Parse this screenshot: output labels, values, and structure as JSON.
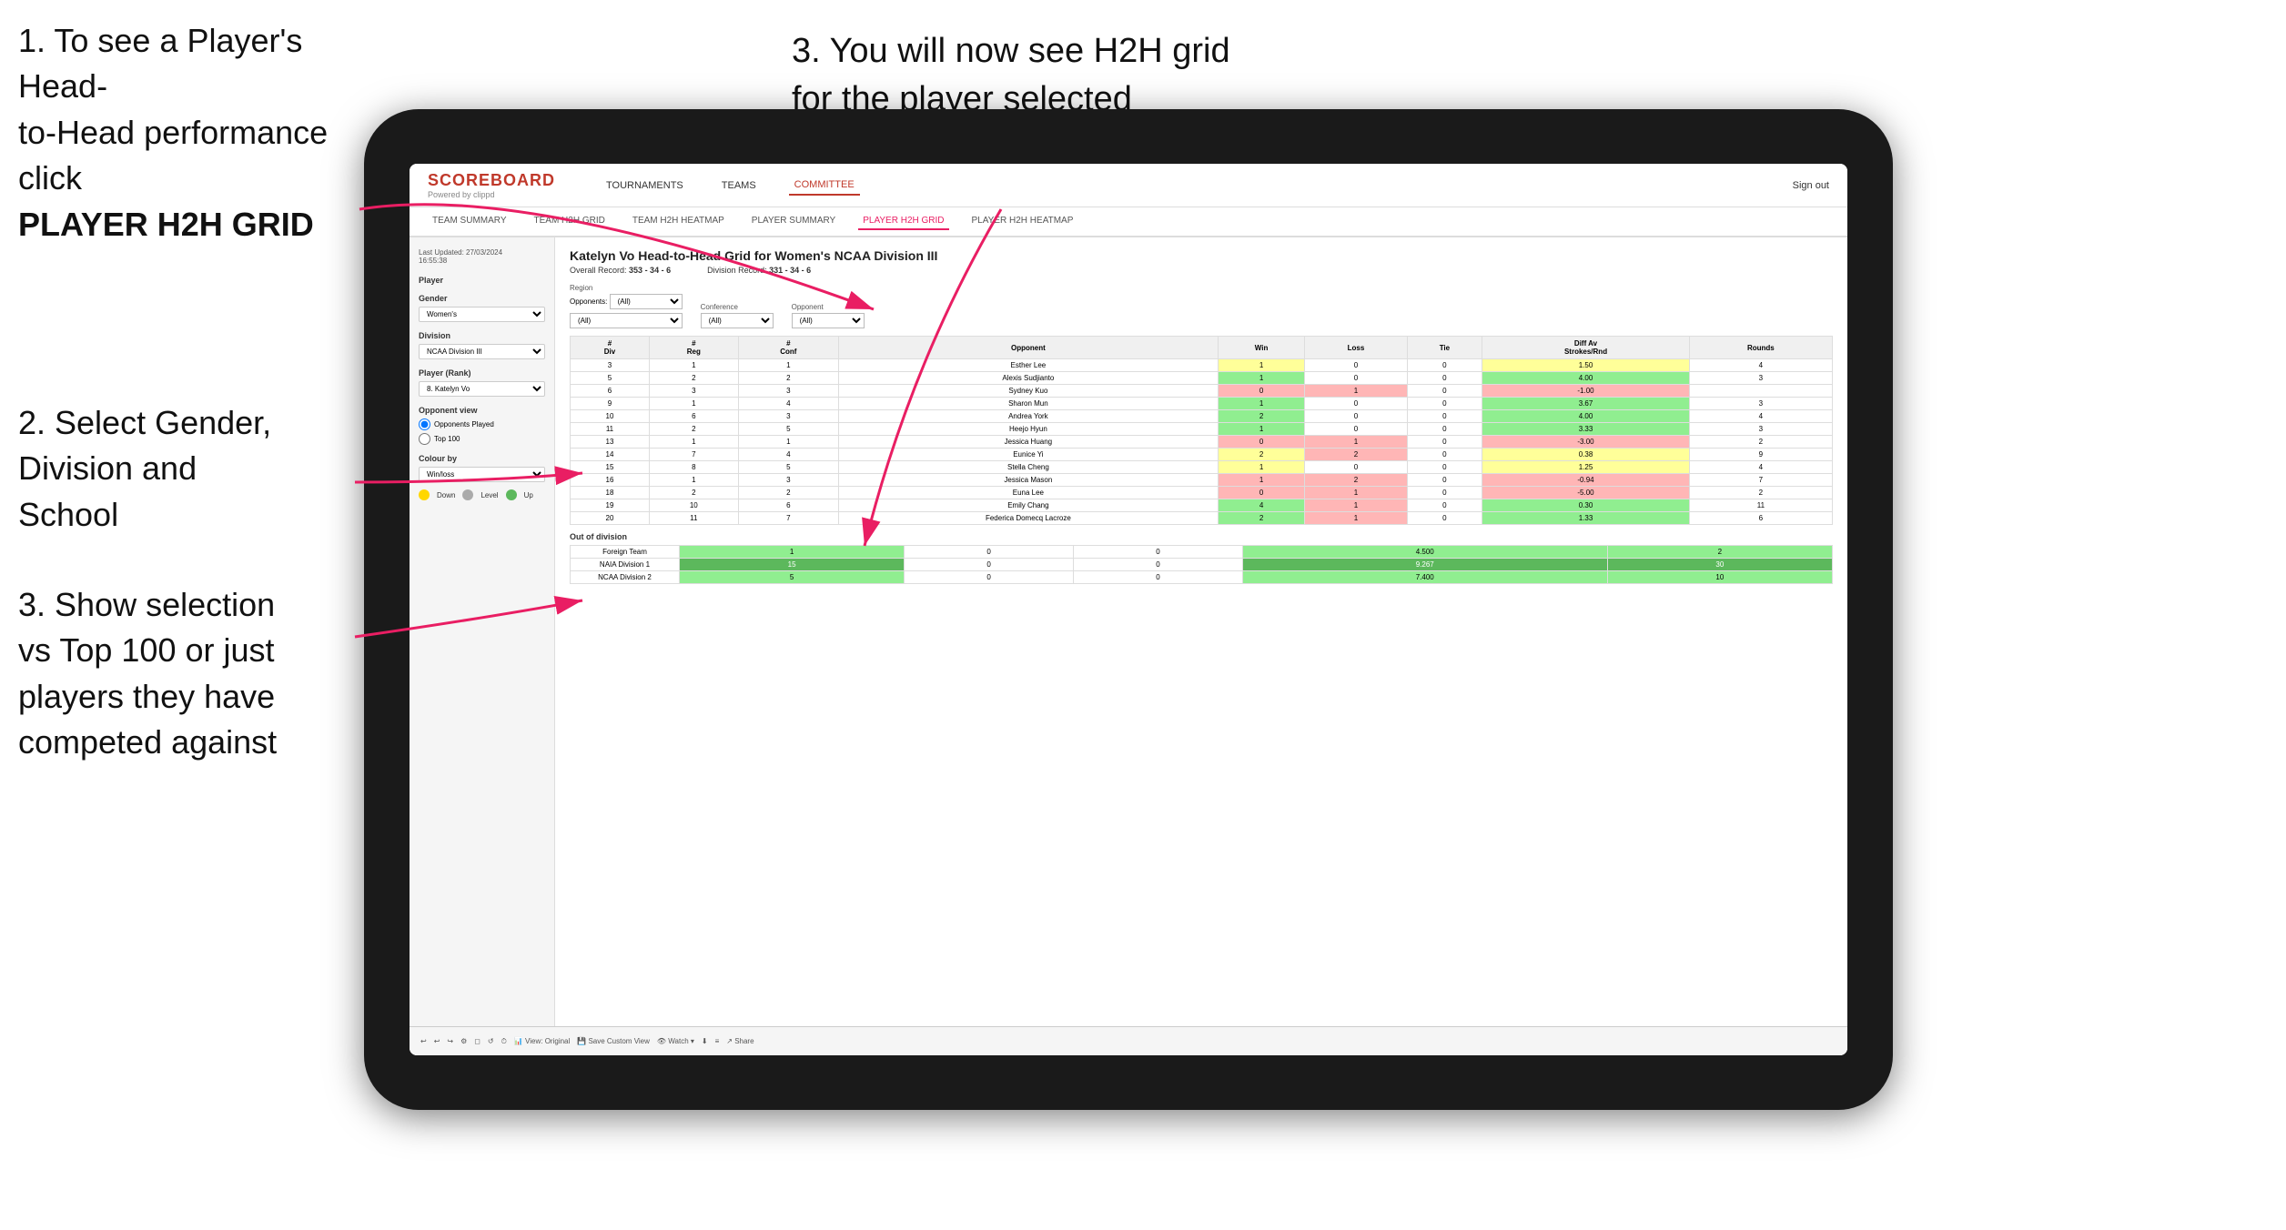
{
  "instructions": {
    "step1_line1": "1. To see a Player's Head-",
    "step1_line2": "to-Head performance click",
    "step1_bold": "PLAYER H2H GRID",
    "step2_title": "2. Select Gender,",
    "step2_line2": "Division and",
    "step2_line3": "School",
    "step3_title": "3. You will now see H2H grid",
    "step3_line2": "for the player selected",
    "step3b_title": "3. Show selection",
    "step3b_line2": "vs Top 100 or just",
    "step3b_line3": "players they have",
    "step3b_line4": "competed against"
  },
  "nav": {
    "logo": "SCOREBOARD",
    "logo_sub": "Powered by clippd",
    "items": [
      "TOURNAMENTS",
      "TEAMS",
      "COMMITTEE"
    ],
    "sign_out": "Sign out",
    "active": "COMMITTEE"
  },
  "sub_nav": {
    "items": [
      "TEAM SUMMARY",
      "TEAM H2H GRID",
      "TEAM H2H HEATMAP",
      "PLAYER SUMMARY",
      "PLAYER H2H GRID",
      "PLAYER H2H HEATMAP"
    ],
    "active": "PLAYER H2H GRID"
  },
  "sidebar": {
    "updated": "Last Updated: 27/03/2024",
    "updated2": "16:55:38",
    "player_label": "Player",
    "gender_label": "Gender",
    "gender_value": "Women's",
    "division_label": "Division",
    "division_value": "NCAA Division III",
    "player_rank_label": "Player (Rank)",
    "player_rank_value": "8. Katelyn Vo",
    "opponent_view_label": "Opponent view",
    "radio1": "Opponents Played",
    "radio2": "Top 100",
    "colour_label": "Colour by",
    "colour_value": "Win/loss",
    "legend_down": "Down",
    "legend_level": "Level",
    "legend_up": "Up"
  },
  "main": {
    "title": "Katelyn Vo Head-to-Head Grid for Women's NCAA Division III",
    "overall_record_label": "Overall Record:",
    "overall_record": "353 - 34 - 6",
    "division_record_label": "Division Record:",
    "division_record": "331 - 34 - 6",
    "opponents_label": "Opponents:",
    "opponents_value": "(All)",
    "region_label": "Region",
    "conference_label": "Conference",
    "opponent_label": "Opponent",
    "col_div": "#\nDiv",
    "col_reg": "#\nReg",
    "col_conf": "#\nConf",
    "col_opponent": "Opponent",
    "col_win": "Win",
    "col_loss": "Loss",
    "col_tie": "Tie",
    "col_diff": "Diff Av\nStrokes/Rnd",
    "col_rounds": "Rounds"
  },
  "table_rows": [
    {
      "div": 3,
      "reg": 1,
      "conf": 1,
      "opponent": "Esther Lee",
      "win": 1,
      "loss": 0,
      "tie": 0,
      "diff": 1.5,
      "rounds": 4,
      "win_color": "yellow"
    },
    {
      "div": 5,
      "reg": 2,
      "conf": 2,
      "opponent": "Alexis Sudjianto",
      "win": 1,
      "loss": 0,
      "tie": 0,
      "diff": 4.0,
      "rounds": 3,
      "win_color": "green"
    },
    {
      "div": 6,
      "reg": 3,
      "conf": 3,
      "opponent": "Sydney Kuo",
      "win": 0,
      "loss": 1,
      "tie": 0,
      "diff": -1.0,
      "rounds": null,
      "win_color": "red"
    },
    {
      "div": 9,
      "reg": 1,
      "conf": 4,
      "opponent": "Sharon Mun",
      "win": 1,
      "loss": 0,
      "tie": 0,
      "diff": 3.67,
      "rounds": 3,
      "win_color": "green"
    },
    {
      "div": 10,
      "reg": 6,
      "conf": 3,
      "opponent": "Andrea York",
      "win": 2,
      "loss": 0,
      "tie": 0,
      "diff": 4.0,
      "rounds": 4,
      "win_color": "green"
    },
    {
      "div": 11,
      "reg": 2,
      "conf": 5,
      "opponent": "Heejo Hyun",
      "win": 1,
      "loss": 0,
      "tie": 0,
      "diff": 3.33,
      "rounds": 3,
      "win_color": "green"
    },
    {
      "div": 13,
      "reg": 1,
      "conf": 1,
      "opponent": "Jessica Huang",
      "win": 0,
      "loss": 1,
      "tie": 0,
      "diff": -3.0,
      "rounds": 2,
      "win_color": "red"
    },
    {
      "div": 14,
      "reg": 7,
      "conf": 4,
      "opponent": "Eunice Yi",
      "win": 2,
      "loss": 2,
      "tie": 0,
      "diff": 0.38,
      "rounds": 9,
      "win_color": "yellow"
    },
    {
      "div": 15,
      "reg": 8,
      "conf": 5,
      "opponent": "Stella Cheng",
      "win": 1,
      "loss": 0,
      "tie": 0,
      "diff": 1.25,
      "rounds": 4,
      "win_color": "yellow"
    },
    {
      "div": 16,
      "reg": 1,
      "conf": 3,
      "opponent": "Jessica Mason",
      "win": 1,
      "loss": 2,
      "tie": 0,
      "diff": -0.94,
      "rounds": 7,
      "win_color": "red"
    },
    {
      "div": 18,
      "reg": 2,
      "conf": 2,
      "opponent": "Euna Lee",
      "win": 0,
      "loss": 1,
      "tie": 0,
      "diff": -5.0,
      "rounds": 2,
      "win_color": "red"
    },
    {
      "div": 19,
      "reg": 10,
      "conf": 6,
      "opponent": "Emily Chang",
      "win": 4,
      "loss": 1,
      "tie": 0,
      "diff": 0.3,
      "rounds": 11,
      "win_color": "green"
    },
    {
      "div": 20,
      "reg": 11,
      "conf": 7,
      "opponent": "Federica Domecq Lacroze",
      "win": 2,
      "loss": 1,
      "tie": 0,
      "diff": 1.33,
      "rounds": 6,
      "win_color": "green"
    }
  ],
  "out_of_division": {
    "label": "Out of division",
    "rows": [
      {
        "name": "Foreign Team",
        "win": 1,
        "loss": 0,
        "tie": 0,
        "diff": 4.5,
        "rounds": 2,
        "win_color": "green"
      },
      {
        "name": "NAIA Division 1",
        "win": 15,
        "loss": 0,
        "tie": 0,
        "diff": 9.267,
        "rounds": 30,
        "win_color": "dark-green"
      },
      {
        "name": "NCAA Division 2",
        "win": 5,
        "loss": 0,
        "tie": 0,
        "diff": 7.4,
        "rounds": 10,
        "win_color": "green"
      }
    ]
  },
  "toolbar": {
    "items": [
      "↩",
      "↩",
      "↪",
      "⚙",
      "◻",
      "↺",
      "⏱",
      "View: Original",
      "Save Custom View",
      "👁 Watch",
      "⬇",
      "≡",
      "Share"
    ]
  },
  "colors": {
    "red_arrow": "#e91e63",
    "nav_active": "#c0392b",
    "tab_active": "#e91e63",
    "win_green": "#90EE90",
    "win_dark_green": "#5cb85c",
    "win_yellow": "#FFFF99",
    "loss_red": "#FFB6B6"
  }
}
